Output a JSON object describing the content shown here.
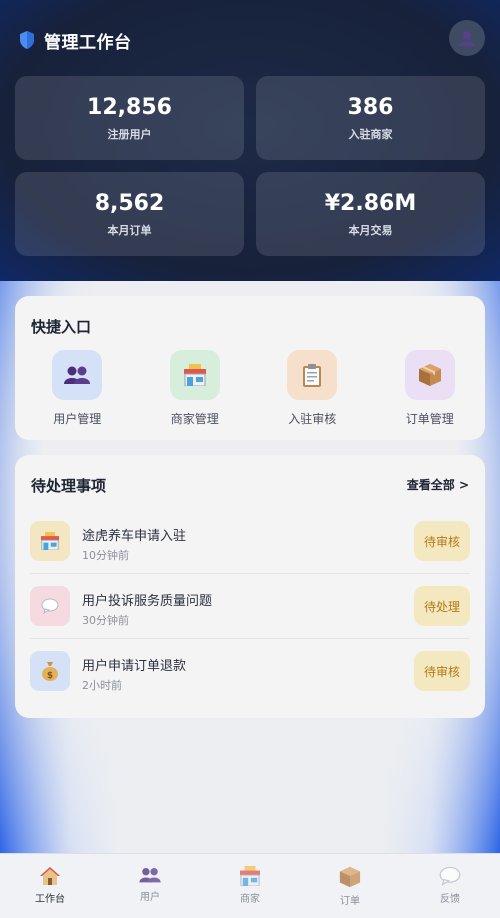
{
  "app": {
    "title": "管理工作台"
  },
  "stats": [
    {
      "value": "12,856",
      "label": "注册用户"
    },
    {
      "value": "386",
      "label": "入驻商家"
    },
    {
      "value": "8,562",
      "label": "本月订单"
    },
    {
      "value": "¥2.86M",
      "label": "本月交易"
    }
  ],
  "quick": {
    "title": "快捷入口",
    "items": [
      {
        "label": "用户管理",
        "icon": "users-icon"
      },
      {
        "label": "商家管理",
        "icon": "store-icon"
      },
      {
        "label": "入驻审核",
        "icon": "clipboard-icon"
      },
      {
        "label": "订单管理",
        "icon": "package-icon"
      }
    ]
  },
  "pending": {
    "title": "待处理事项",
    "view_all": "查看全部 >",
    "tasks": [
      {
        "title": "途虎养车申请入驻",
        "time": "10分钟前",
        "status": "待审核",
        "icon": "store-icon"
      },
      {
        "title": "用户投诉服务质量问题",
        "time": "30分钟前",
        "status": "待处理",
        "icon": "speech-bubble-icon"
      },
      {
        "title": "用户申请订单退款",
        "time": "2小时前",
        "status": "待审核",
        "icon": "money-bag-icon"
      }
    ]
  },
  "tabs": [
    {
      "label": "工作台",
      "icon": "house-icon",
      "active": true
    },
    {
      "label": "用户",
      "icon": "users-icon"
    },
    {
      "label": "商家",
      "icon": "store-icon"
    },
    {
      "label": "订单",
      "icon": "package-icon"
    },
    {
      "label": "反馈",
      "icon": "speech-bubble-icon"
    }
  ],
  "colors": {
    "header_bg": "#17213a",
    "accent_blue": "#2a62e6",
    "status_bg": "#f3e8bf",
    "status_text": "#b57a14"
  }
}
